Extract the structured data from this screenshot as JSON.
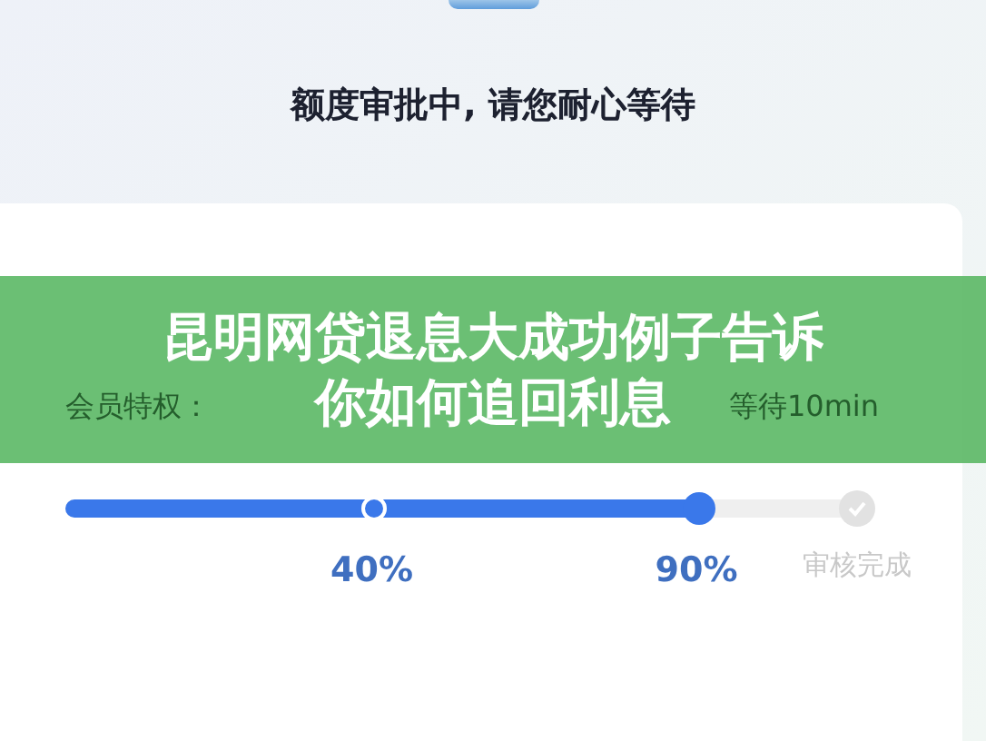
{
  "status_title": "额度审批中, 请您耐心等待",
  "member_line": {
    "label": "会员特权：",
    "wait": "等待10min"
  },
  "progress": {
    "level": 0.8,
    "steps": [
      {
        "label": "40%",
        "reached": true
      },
      {
        "label": "90%",
        "reached": true
      },
      {
        "label": "审核完成",
        "reached": false
      }
    ]
  },
  "banner": {
    "lines": [
      "昆明网贷退息大成功例子告诉",
      "你如何追回利息"
    ]
  }
}
